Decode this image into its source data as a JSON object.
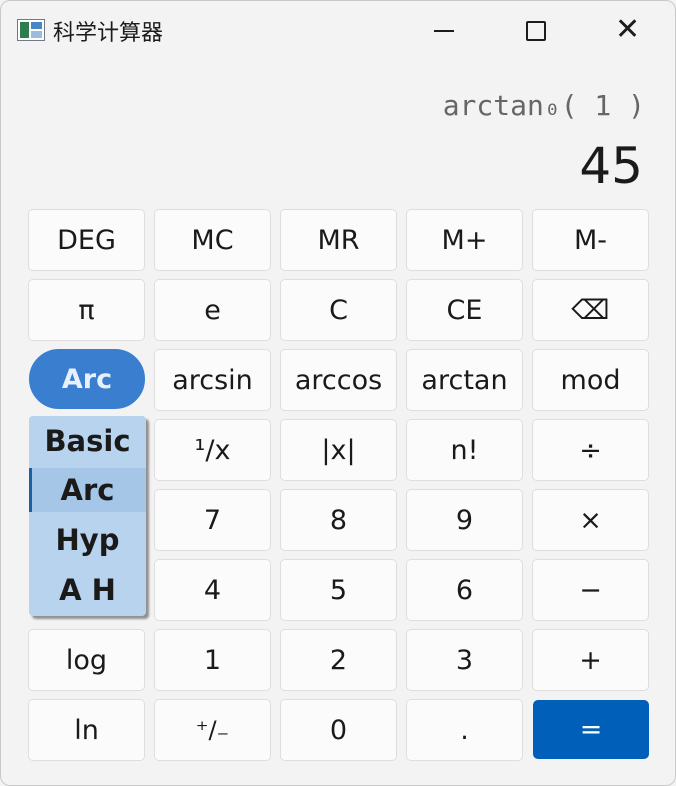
{
  "window": {
    "title": "科学计算器"
  },
  "display": {
    "expression": "arctan₀( 1 )",
    "result": "45"
  },
  "keys": {
    "deg": "DEG",
    "mc": "MC",
    "mr": "MR",
    "mplus": "M+",
    "mminus": "M-",
    "pi": "π",
    "e": "e",
    "c": "C",
    "ce": "CE",
    "backspace": "⌫",
    "arc": "Arc",
    "arcsin": "arcsin",
    "arccos": "arccos",
    "arctan": "arctan",
    "mod": "mod",
    "reciprocal": "¹/x",
    "abs": "|x|",
    "factorial": "n!",
    "divide": "÷",
    "n7": "7",
    "n8": "8",
    "n9": "9",
    "multiply": "×",
    "n4": "4",
    "n5": "5",
    "n6": "6",
    "minus": "−",
    "log": "log",
    "n1": "1",
    "n2": "2",
    "n3": "3",
    "plus": "+",
    "ln": "ln",
    "negate": "⁺/₋",
    "n0": "0",
    "decimal": ".",
    "equals": "="
  },
  "mode_menu": {
    "items": [
      "Basic",
      "Arc",
      "Hyp",
      "A H"
    ],
    "selected": "Arc"
  },
  "colors": {
    "accent": "#005fb8",
    "arc_button": "#3a7fcf",
    "menu_bg": "#b8d3ee"
  }
}
